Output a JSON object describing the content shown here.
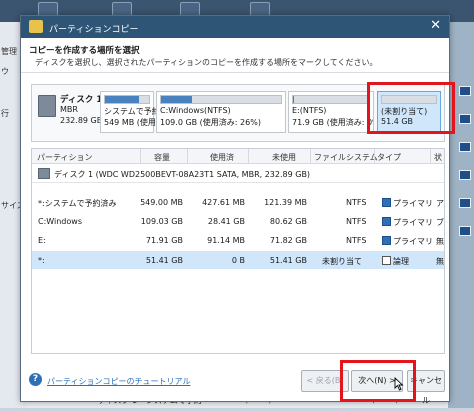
{
  "background": {
    "left_labels": [
      "管理",
      "ウ",
      "行",
      "サイズ"
    ],
    "bottom": {
      "disk_name": "ディスク 1",
      "disk_type": "MBR",
      "part1": "システムで予約",
      "part2": "C:Windows(NTFS)",
      "part3": "E:(NTFS)"
    }
  },
  "dialog": {
    "title": "パーティションコピー",
    "close_glyph": "✕",
    "heading": "コピーを作成する場所を選択",
    "subheading": "ディスクを選択し、選択されたパーティションのコピーを作成する場所をマークしてください。"
  },
  "diskmap": {
    "disk_name": "ディスク 1",
    "disk_type": "MBR",
    "disk_size": "232.89 GB",
    "partitions": [
      {
        "line1": "システムで予約",
        "line2": "549 MB (使用済",
        "fill": 0.78,
        "selected": false
      },
      {
        "line1": "C:Windows(NTFS)",
        "line2": "109.0 GB (使用済み: 26%)",
        "fill": 0.26,
        "selected": false
      },
      {
        "line1": "E:(NTFS)",
        "line2": "71.9 GB (使用済み: 0%",
        "fill": 0.01,
        "selected": false
      },
      {
        "line1": "(未割り当て)",
        "line2": "51.4 GB",
        "fill": 0,
        "selected": true
      }
    ]
  },
  "table": {
    "headers": [
      "パーティション",
      "容量",
      "使用済",
      "未使用",
      "ファイルシステム",
      "タイプ",
      "状"
    ],
    "disk_row": "ディスク 1 (WDC WD2500BEVT-08A23T1 SATA, MBR, 232.89 GB)",
    "rows": [
      {
        "partition": "*:システムで予約済み",
        "capacity": "549.00 MB",
        "used": "427.61 MB",
        "unused": "121.39 MB",
        "fs": "NTFS",
        "type": "プライマリ",
        "status": "ア",
        "type_icon": "primary-square-icon",
        "selected": false
      },
      {
        "partition": "C:Windows",
        "capacity": "109.03 GB",
        "used": "28.41 GB",
        "unused": "80.62 GB",
        "fs": "NTFS",
        "type": "プライマリ",
        "status": "ブ",
        "type_icon": "primary-square-icon",
        "selected": false
      },
      {
        "partition": "E:",
        "capacity": "71.91 GB",
        "used": "91.14 MB",
        "unused": "71.82 GB",
        "fs": "NTFS",
        "type": "プライマリ",
        "status": "無",
        "type_icon": "primary-square-icon",
        "selected": false
      },
      {
        "partition": "*:",
        "capacity": "51.41 GB",
        "used": "0 B",
        "unused": "51.41 GB",
        "fs": "未割り当て",
        "type": "論理",
        "status": "無",
        "type_icon": "logical-square-icon",
        "selected": true
      }
    ]
  },
  "footer": {
    "help_glyph": "?",
    "help_link": "パーティションコピーのチュートリアル",
    "back_button": "< 戻る(B)",
    "next_button": "次へ(N) >",
    "cancel_button": "キャンセル"
  },
  "colors": {
    "titlebar": "#2f5576",
    "selection": "#cfe6fb",
    "highlight": "#e2141c",
    "primary": "#2f6fb6"
  }
}
